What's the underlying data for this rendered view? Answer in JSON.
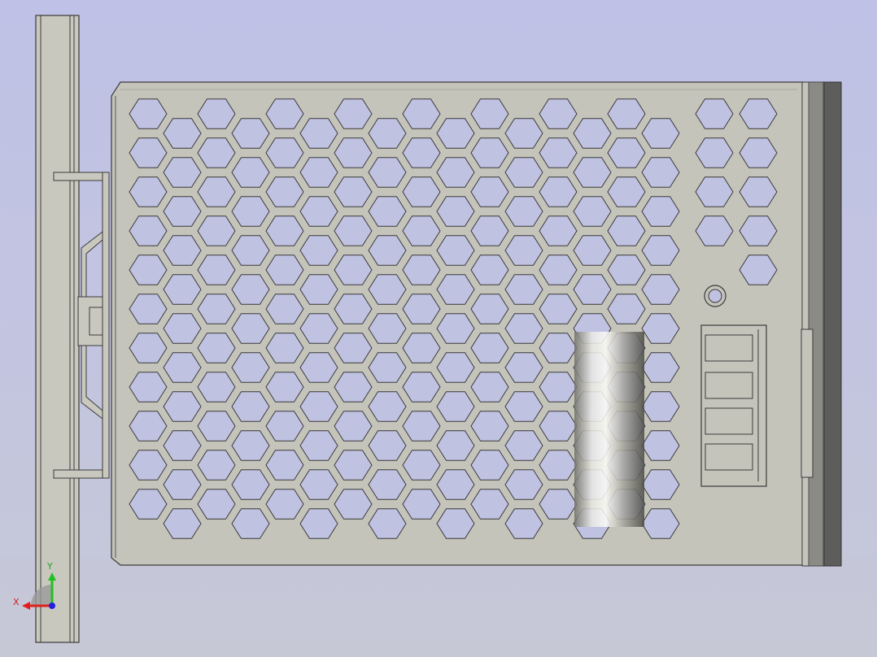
{
  "viewport": {
    "background_top": "#bfc1e6",
    "background_bottom": "#c6c8d6"
  },
  "model": {
    "body_color": "#c5c4bb",
    "edge_color": "#3a3a3a",
    "cutout_color": "#c0c2e2",
    "rear_panel_color": "#6e6e6e",
    "handle_color": "#c9c8bf"
  },
  "triad": {
    "x_label": "X",
    "y_label": "Y",
    "x_color": "#e02020",
    "y_color": "#20c020",
    "z_color": "#2020e0"
  }
}
